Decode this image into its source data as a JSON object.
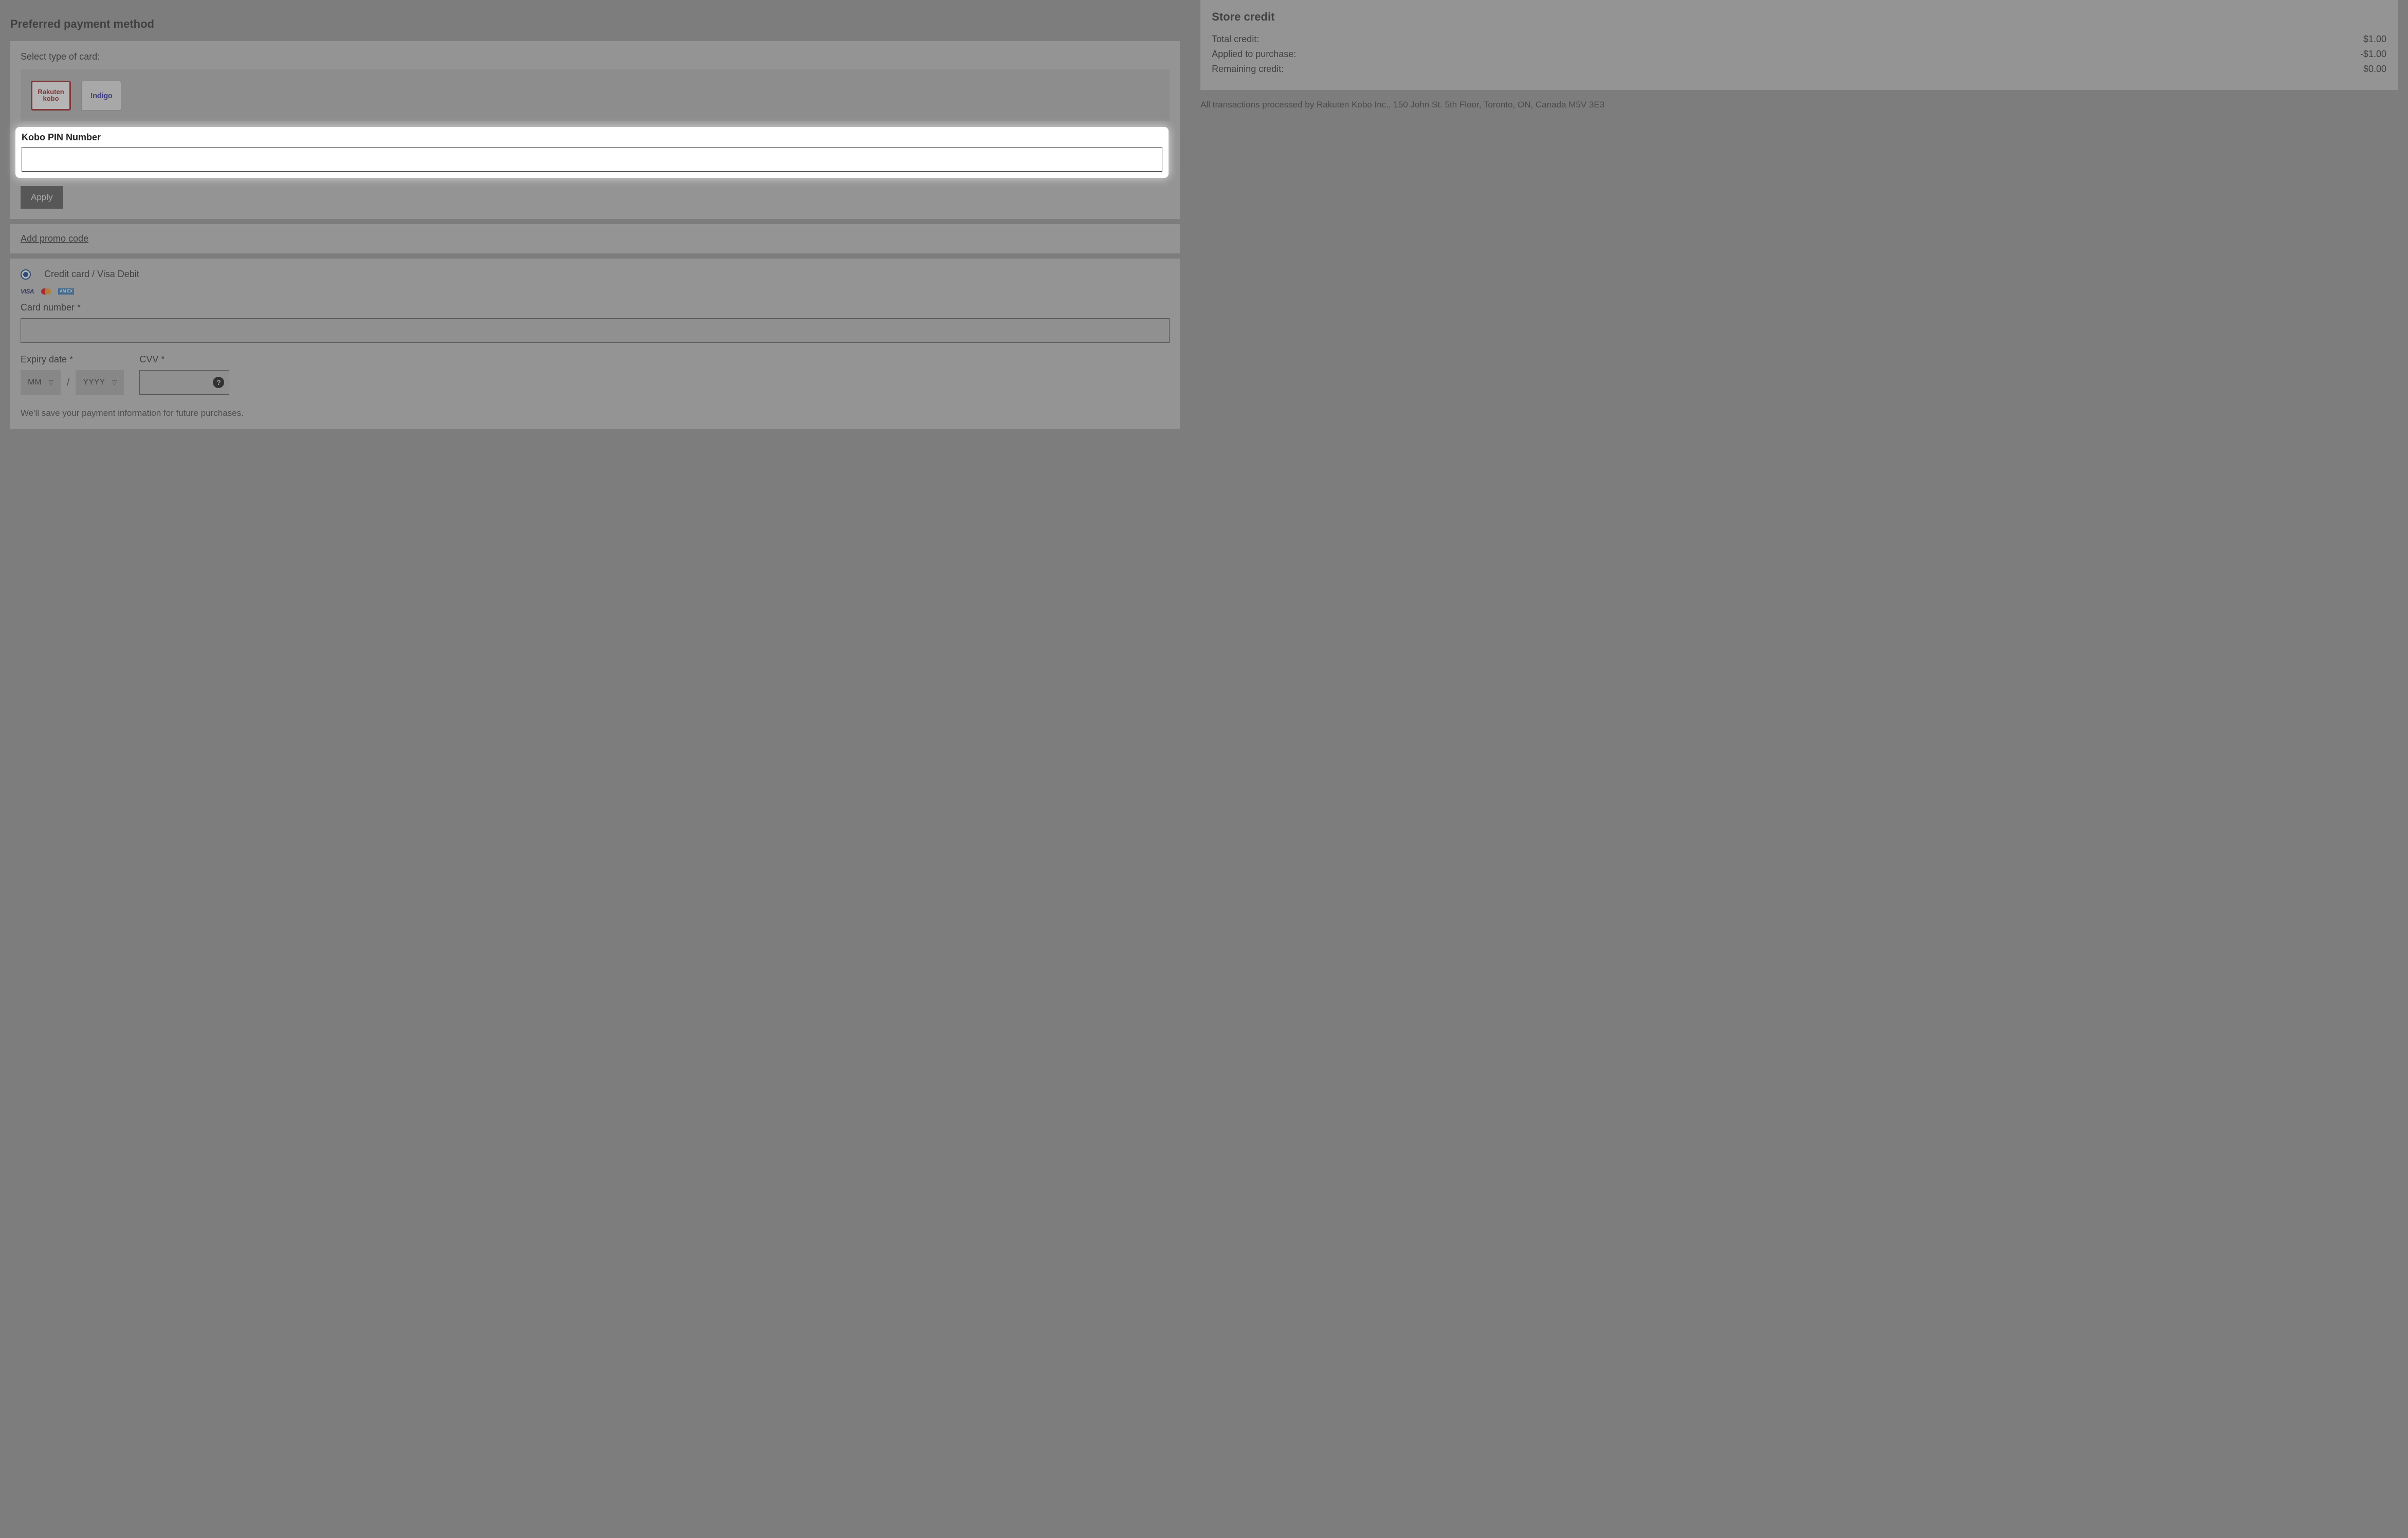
{
  "left": {
    "title": "Preferred payment method",
    "select_card_label": "Select type of card:",
    "cards": {
      "rakuten_line1": "Rakuten",
      "rakuten_line2": "kobo",
      "indigo": "!ndigo"
    },
    "pin_label": "Kobo PIN Number",
    "apply": "Apply",
    "promo_link": "Add promo code",
    "cc_radio_label": "Credit card / Visa Debit",
    "logos": {
      "visa": "VISA",
      "amex": "AM\nEX"
    },
    "card_number_label": "Card number *",
    "expiry_label": "Expiry date *",
    "month_placeholder": "MM",
    "year_placeholder": "YYYY",
    "slash": "/",
    "cvv_label": "CVV *",
    "help_glyph": "?",
    "save_note": "We'll save your payment information for future purchases."
  },
  "right": {
    "title": "Store credit",
    "rows": [
      {
        "label": "Total credit:",
        "value": "$1.00"
      },
      {
        "label": "Applied to purchase:",
        "value": "-$1.00"
      },
      {
        "label": "Remaining credit:",
        "value": "$0.00"
      }
    ],
    "legal": "All transactions processed by Rakuten Kobo Inc., 150 John St. 5th Floor, Toronto, ON, Canada M5V 3E3"
  }
}
